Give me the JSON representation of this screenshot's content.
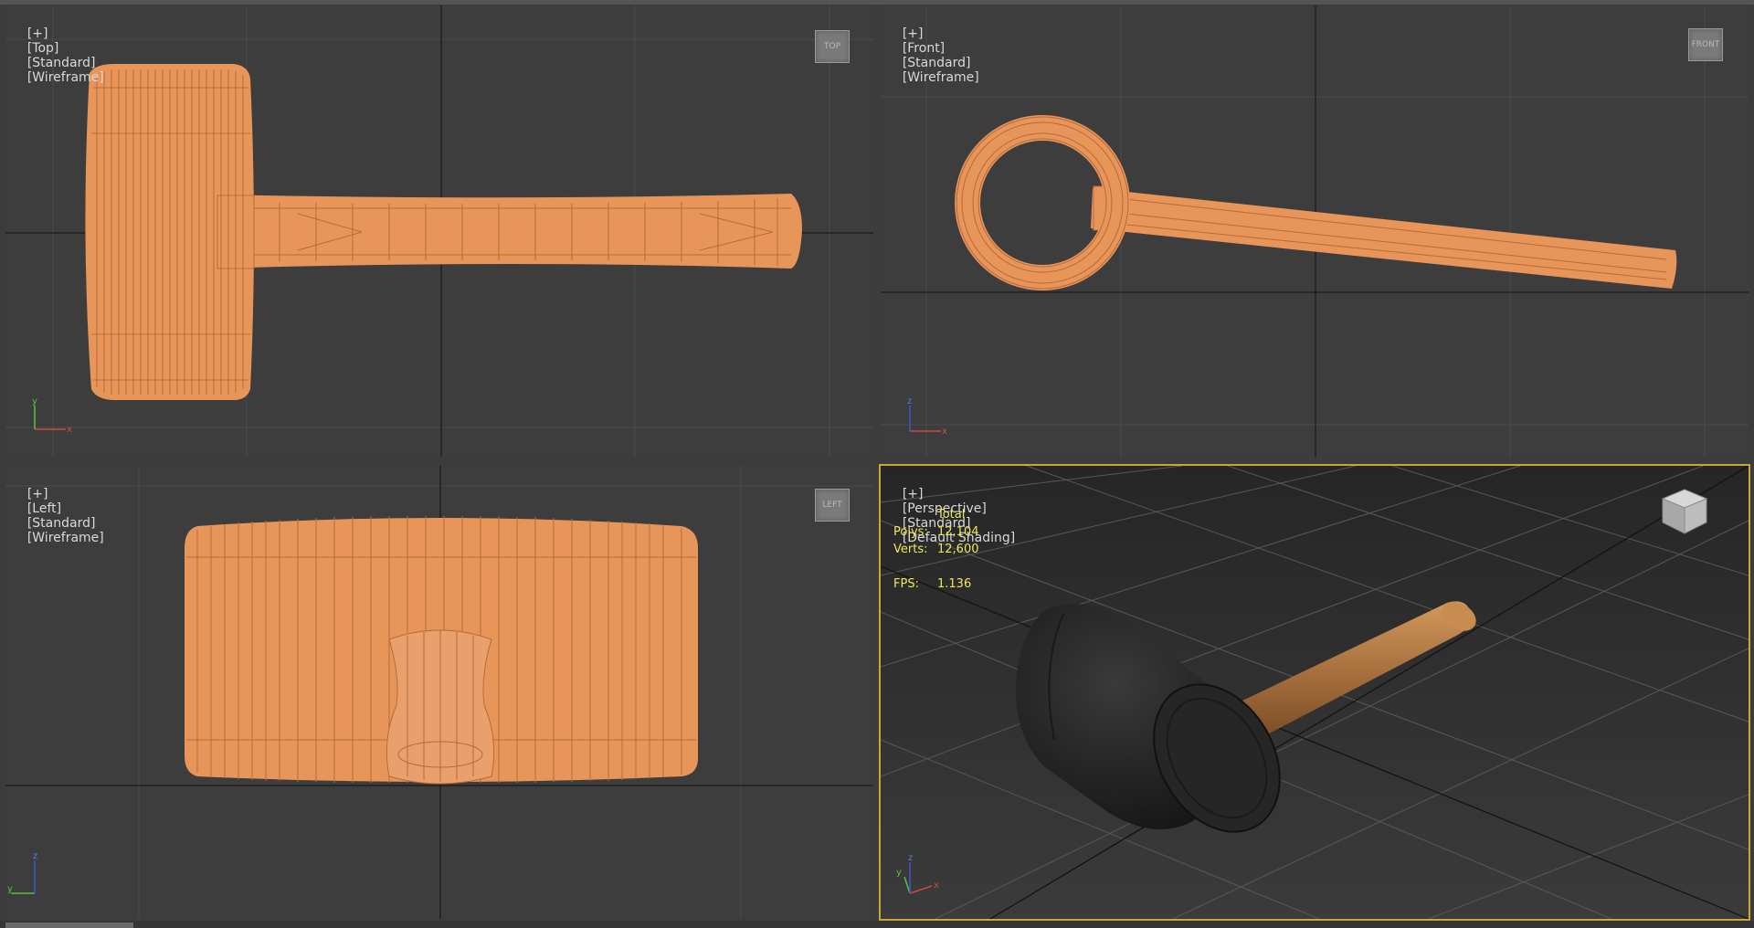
{
  "viewports": {
    "top": {
      "plus": "[+]",
      "view": "[Top]",
      "style": "[Standard]",
      "mode": "[Wireframe]",
      "cube": "TOP"
    },
    "front": {
      "plus": "[+]",
      "view": "[Front]",
      "style": "[Standard]",
      "mode": "[Wireframe]",
      "cube": "FRONT"
    },
    "left": {
      "plus": "[+]",
      "view": "[Left]",
      "style": "[Standard]",
      "mode": "[Wireframe]",
      "cube": "LEFT"
    },
    "persp": {
      "plus": "[+]",
      "view": "[Perspective]",
      "style": "[Standard]",
      "mode": "[Default Shading]"
    }
  },
  "stats": {
    "header": "Total",
    "polys_label": "Polys:",
    "polys": "12,104",
    "verts_label": "Verts:",
    "verts": "12,600",
    "fps_label": "FPS:",
    "fps": "1.136"
  },
  "axes": {
    "x": "x",
    "y": "y",
    "z": "z"
  },
  "colors": {
    "viewport_bg": "#3d3d3d",
    "wireframe": "#e8955a",
    "wire_line": "#b86a3a",
    "active_border": "#c8a834",
    "stats_text": "#f0e65a"
  }
}
